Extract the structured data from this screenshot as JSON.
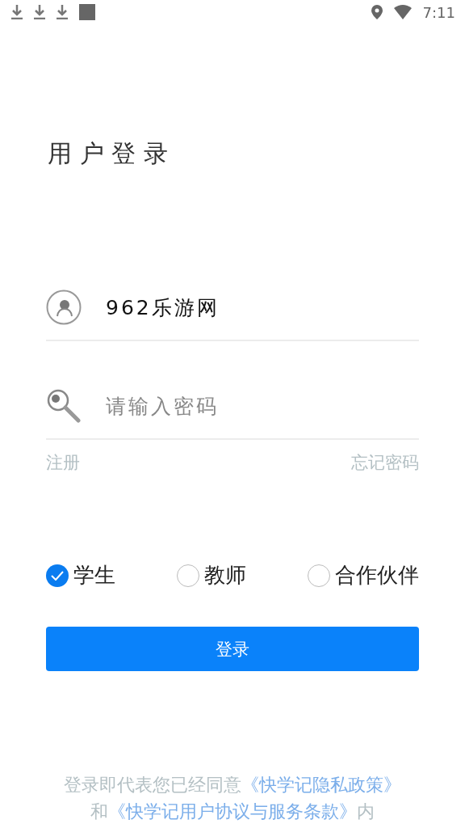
{
  "status_bar": {
    "time": "7:11"
  },
  "title": "用 户 登 录",
  "username": {
    "value": "962乐游网"
  },
  "password": {
    "placeholder": "请输入密码"
  },
  "links": [
    "注册",
    "忘记密码"
  ],
  "roles": [
    {
      "label": "学生",
      "selected": true
    },
    {
      "label": "教师",
      "selected": false
    },
    {
      "label": "合作伙伴",
      "selected": false
    }
  ],
  "login_button": "登录",
  "terms": {
    "before": "登录即代表您已经同意",
    "privacy_link": "《快学记隐私政策》",
    "middle": "和",
    "agreement_link": "《快学记用户协议与服务条款》",
    "after": "内"
  }
}
